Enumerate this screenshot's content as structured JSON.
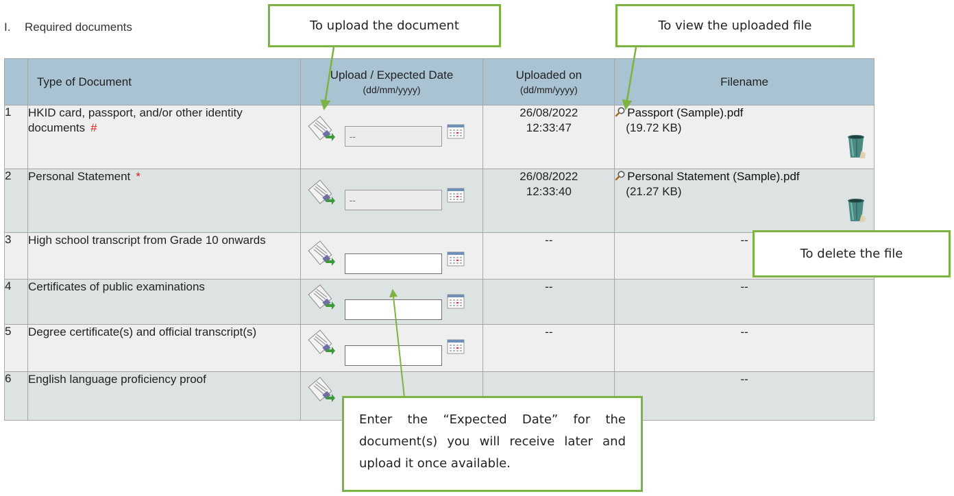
{
  "section": {
    "number": "I.",
    "title": "Required documents"
  },
  "columns": {
    "num": "",
    "type": "Type of Document",
    "upload": "Upload / Expected Date",
    "upload_sub": "(dd/mm/yyyy)",
    "uploaded": "Uploaded on",
    "uploaded_sub": "(dd/mm/yyyy)",
    "filename": "Filename"
  },
  "rows": [
    {
      "num": "1",
      "type": "HKID card, passport, and/or other identity documents",
      "mark": "#",
      "expected_date": "--",
      "uploaded_date": "26/08/2022",
      "uploaded_time": "12:33:47",
      "file_name": "Passport (Sample).pdf",
      "file_size": "(19.72 KB)"
    },
    {
      "num": "2",
      "type": "Personal Statement",
      "mark": "*",
      "expected_date": "--",
      "uploaded_date": "26/08/2022",
      "uploaded_time": "12:33:40",
      "file_name": "Personal Statement (Sample).pdf",
      "file_size": "(21.27 KB)"
    },
    {
      "num": "3",
      "type": "High school transcript from Grade 10 onwards",
      "expected_date": "",
      "uploaded_placeholder": "--",
      "file_placeholder": "--"
    },
    {
      "num": "4",
      "type": "Certificates of public examinations",
      "expected_date": "",
      "uploaded_placeholder": "--",
      "file_placeholder": "--"
    },
    {
      "num": "5",
      "type": "Degree certificate(s) and official transcript(s)",
      "expected_date": "",
      "uploaded_placeholder": "--",
      "file_placeholder": "--"
    },
    {
      "num": "6",
      "type": "English language proficiency proof",
      "file_placeholder": "--"
    }
  ],
  "callouts": {
    "upload": "To upload the document",
    "view": "To view the uploaded file",
    "delete": "To delete the file",
    "expected_date": "Enter the “Expected Date” for the document(s) you will receive later and upload it once available."
  },
  "colors": {
    "header_bg": "#a9c3d3",
    "row_light": "#efeff0",
    "row_dark": "#dde2e3",
    "callout_border": "#7cb342",
    "required_mark": "#dd2222"
  },
  "icons": {
    "upload": "upload-document-icon",
    "calendar": "calendar-icon",
    "view": "magnifier-icon",
    "delete": "trash-bin-icon"
  }
}
